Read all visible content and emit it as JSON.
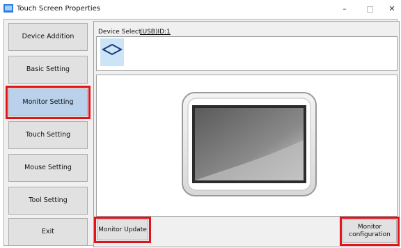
{
  "window": {
    "title": "Touch Screen Properties",
    "minimize_glyph": "–",
    "close_glyph": "✕"
  },
  "sidebar": {
    "items": [
      {
        "label": "Device Addition",
        "active": false
      },
      {
        "label": "Basic Setting",
        "active": false
      },
      {
        "label": "Monitor Setting",
        "active": true
      },
      {
        "label": "Touch Setting",
        "active": false
      },
      {
        "label": "Mouse Setting",
        "active": false
      },
      {
        "label": "Tool Setting",
        "active": false
      },
      {
        "label": "Exit",
        "active": false
      }
    ]
  },
  "device": {
    "select_label": "Device Select",
    "selected_id": "(USB)ID:1"
  },
  "buttons": {
    "monitor_update": "Monitor Update",
    "monitor_config_line1": "Monitor",
    "monitor_config_line2": "configuration"
  },
  "icons": {
    "app": "touch-screen-icon",
    "device": "monitor-device-icon"
  },
  "colors": {
    "highlight": "#e4131b",
    "active_nav": "#b9d1ea",
    "thumb_bg": "#cde4f7"
  }
}
